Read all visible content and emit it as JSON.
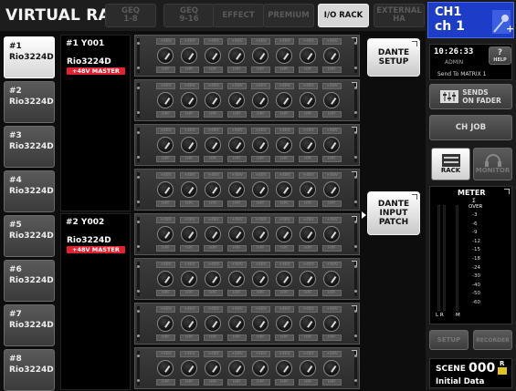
{
  "header": {
    "title": "VIRTUAL RACK",
    "tabs": [
      {
        "label": "GEQ\n1-8",
        "active": false
      },
      {
        "label": "GEQ\n9-16",
        "active": false
      },
      {
        "label": "EFFECT",
        "active": false
      },
      {
        "label": "PREMIUM",
        "active": false
      },
      {
        "label": "I/O RACK",
        "active": true
      },
      {
        "label": "EXTERNAL\nHA",
        "active": false
      }
    ]
  },
  "racks": [
    {
      "num": "#1",
      "model": "Rio3224D"
    },
    {
      "num": "#2",
      "model": "Rio3224D"
    },
    {
      "num": "#3",
      "model": "Rio3224D"
    },
    {
      "num": "#4",
      "model": "Rio3224D"
    },
    {
      "num": "#5",
      "model": "Rio3224D"
    },
    {
      "num": "#6",
      "model": "Rio3224D"
    },
    {
      "num": "#7",
      "model": "Rio3224D"
    },
    {
      "num": "#8",
      "model": "Rio3224D"
    }
  ],
  "devices": [
    {
      "name": "#1 Y001",
      "model": "Rio3224D",
      "tag": "+48V MASTER"
    },
    {
      "name": "#2 Y002",
      "model": "Rio3224D",
      "tag": "+48V MASTER"
    }
  ],
  "channel_strip": {
    "phantom_label": "+48V",
    "hpf_label": "HPF"
  },
  "buttons": {
    "dante_setup": "DANTE\nSETUP",
    "dante_input_patch": "DANTE\nINPUT\nPATCH"
  },
  "channel": {
    "line1": "CH1",
    "line2": "ch 1"
  },
  "status": {
    "time": "10:26:33",
    "user": "ADMIN",
    "help": "?",
    "help_sub": "HELP",
    "send_to": "Send To MATRIX 1"
  },
  "sends_on_fader": {
    "line1": "SENDS",
    "line2": "ON FADER"
  },
  "ch_job": "CH JOB",
  "rack_btn": "RACK",
  "monitor_btn": "MONITOR",
  "meter": {
    "title": "METER",
    "sigma": "Σ",
    "over": "OVER",
    "scale": [
      "-3",
      "-6",
      "-9",
      "-12",
      "-15",
      "-18",
      "-24",
      "-30",
      "-40",
      "-50",
      "-60"
    ],
    "lr": "L R",
    "m": "M"
  },
  "setup_btn": "SETUP",
  "recorder_btn": "RECORDER",
  "scene": {
    "label": "SCENE",
    "number": "000",
    "r": "R",
    "name": "Initial Data"
  }
}
